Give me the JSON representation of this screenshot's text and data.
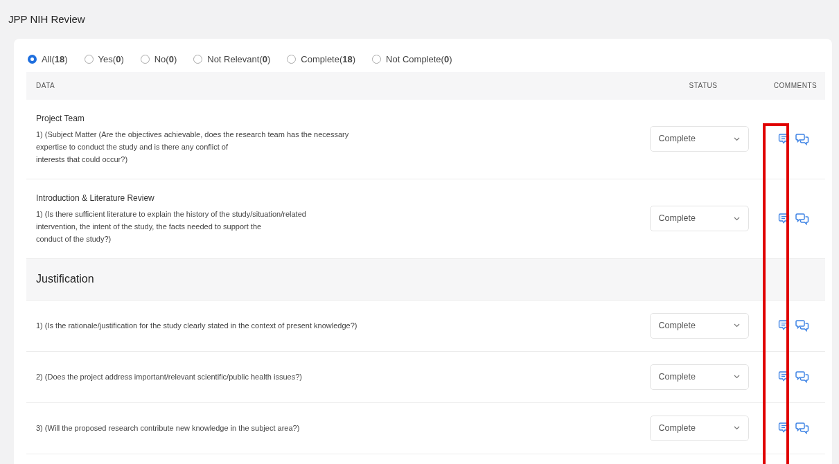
{
  "page": {
    "title": "JPP NIH Review"
  },
  "filters": [
    {
      "label": "All(",
      "count": "18",
      "close": ")",
      "selected": true
    },
    {
      "label": "Yes(",
      "count": "0",
      "close": ")",
      "selected": false
    },
    {
      "label": "No(",
      "count": "0",
      "close": ")",
      "selected": false
    },
    {
      "label": "Not Relevant(",
      "count": "0",
      "close": ")",
      "selected": false
    },
    {
      "label": "Complete(",
      "count": "18",
      "close": ")",
      "selected": false
    },
    {
      "label": "Not Complete(",
      "count": "0",
      "close": ")",
      "selected": false
    }
  ],
  "table": {
    "columns": [
      "DATA",
      "STATUS",
      "COMMENTS"
    ],
    "rows": [
      {
        "kind": "item",
        "title": "Project Team",
        "lines": [
          "1) (Subject Matter (Are the objectives achievable, does the research team has the necessary",
          "expertise to conduct the study and is there any conflict of",
          "interests that could occur?)"
        ],
        "status": "Complete"
      },
      {
        "kind": "item",
        "title": "Introduction & Literature Review",
        "lines": [
          "1) (Is there sufficient literature to explain the history of the study/situation/related",
          "intervention, the intent of the study, the facts needed to support the",
          "conduct of the study?)"
        ],
        "status": "Complete"
      },
      {
        "kind": "section",
        "title": "Justification"
      },
      {
        "kind": "item",
        "lines": [
          "1) (Is the rationale/justification for the study clearly stated in the context of present knowledge?)"
        ],
        "status": "Complete"
      },
      {
        "kind": "item",
        "lines": [
          "2) (Does the project address important/relevant scientific/public health issues?)"
        ],
        "status": "Complete"
      },
      {
        "kind": "item",
        "lines": [
          "3) (Will the proposed research contribute new knowledge in the subject area?)"
        ],
        "status": "Complete"
      }
    ]
  },
  "annotation": {
    "kind": "highlight-box"
  }
}
